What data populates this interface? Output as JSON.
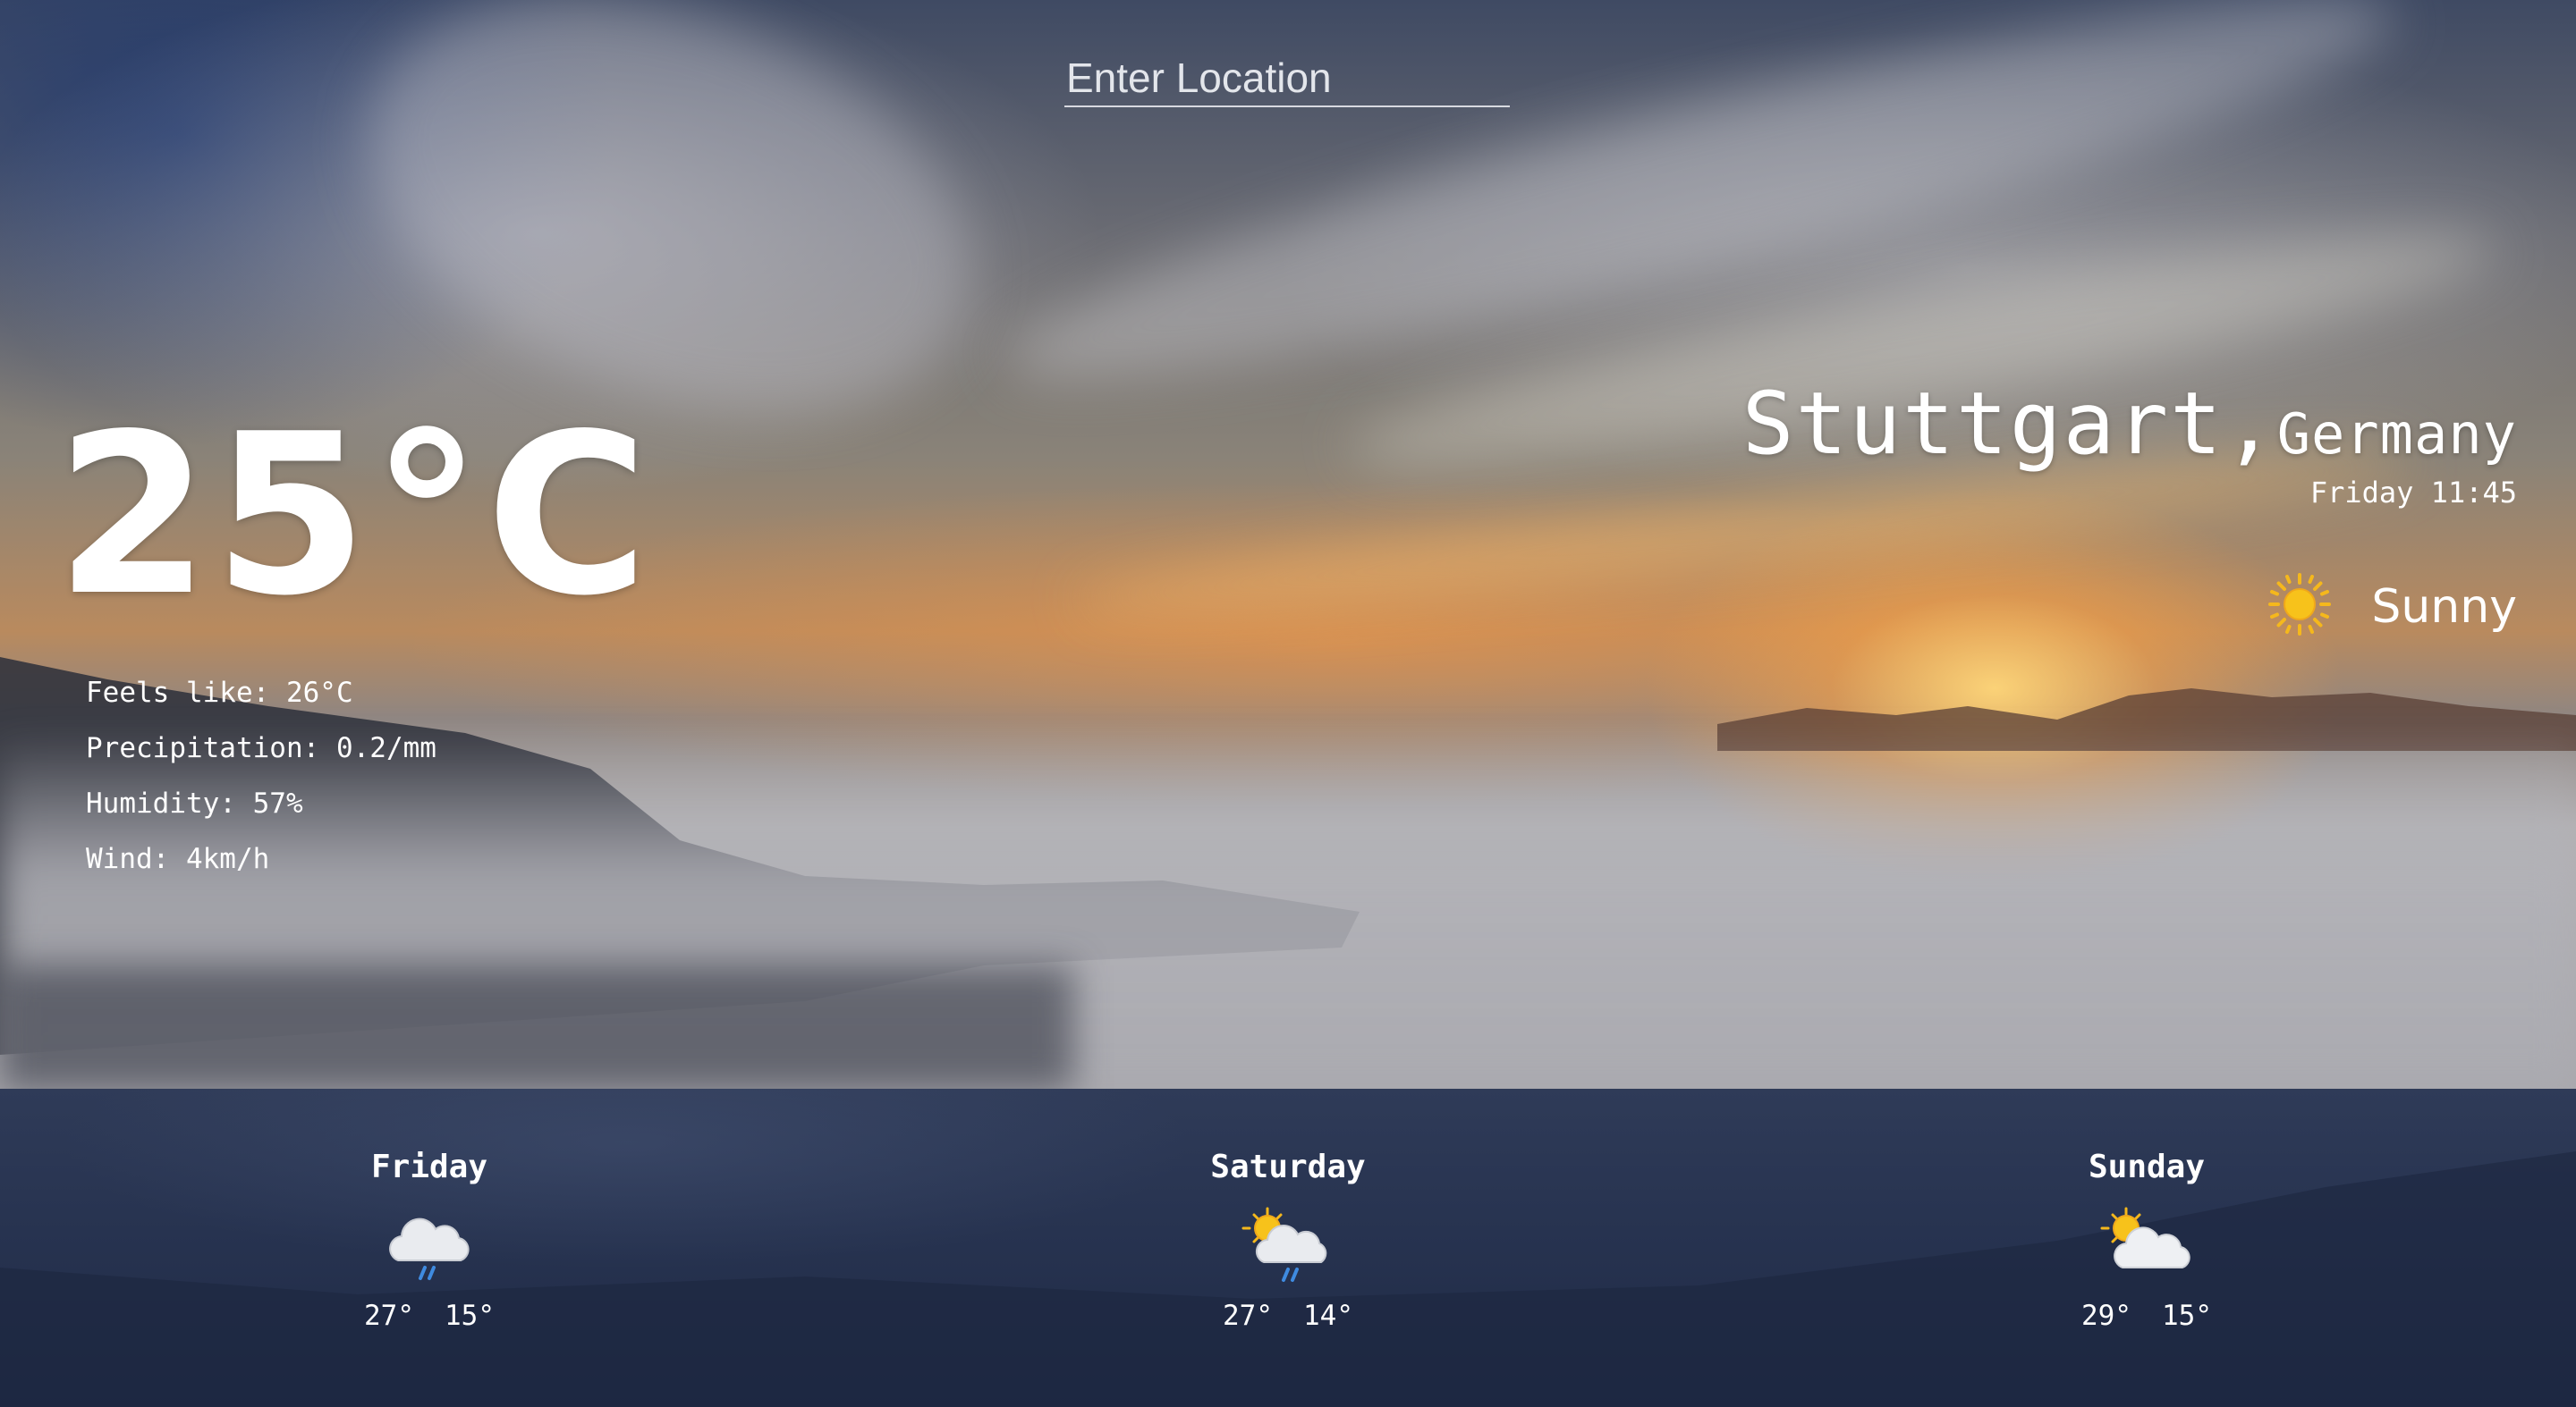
{
  "search": {
    "placeholder": "Enter Location"
  },
  "current": {
    "temperature": "25°C",
    "feels_like": "Feels like: 26°C",
    "precipitation": "Precipitation: 0.2/mm",
    "humidity": "Humidity: 57%",
    "wind": "Wind: 4km/h"
  },
  "location": {
    "city": "Stuttgart,",
    "country": "Germany",
    "datetime": "Friday 11:45",
    "condition": "Sunny",
    "condition_icon": "sun-icon"
  },
  "forecast": [
    {
      "day": "Friday",
      "icon": "cloud-rain-icon",
      "high": "27°",
      "low": "15°"
    },
    {
      "day": "Saturday",
      "icon": "sun-cloud-rain-icon",
      "high": "27°",
      "low": "14°"
    },
    {
      "day": "Sunday",
      "icon": "sun-cloud-icon",
      "high": "29°",
      "low": "15°"
    }
  ],
  "colors": {
    "text": "#ffffff",
    "forecast_panel": "#273350",
    "sun": "#f7c21b",
    "cloud": "#e8eaee",
    "rain": "#3f8be0"
  }
}
